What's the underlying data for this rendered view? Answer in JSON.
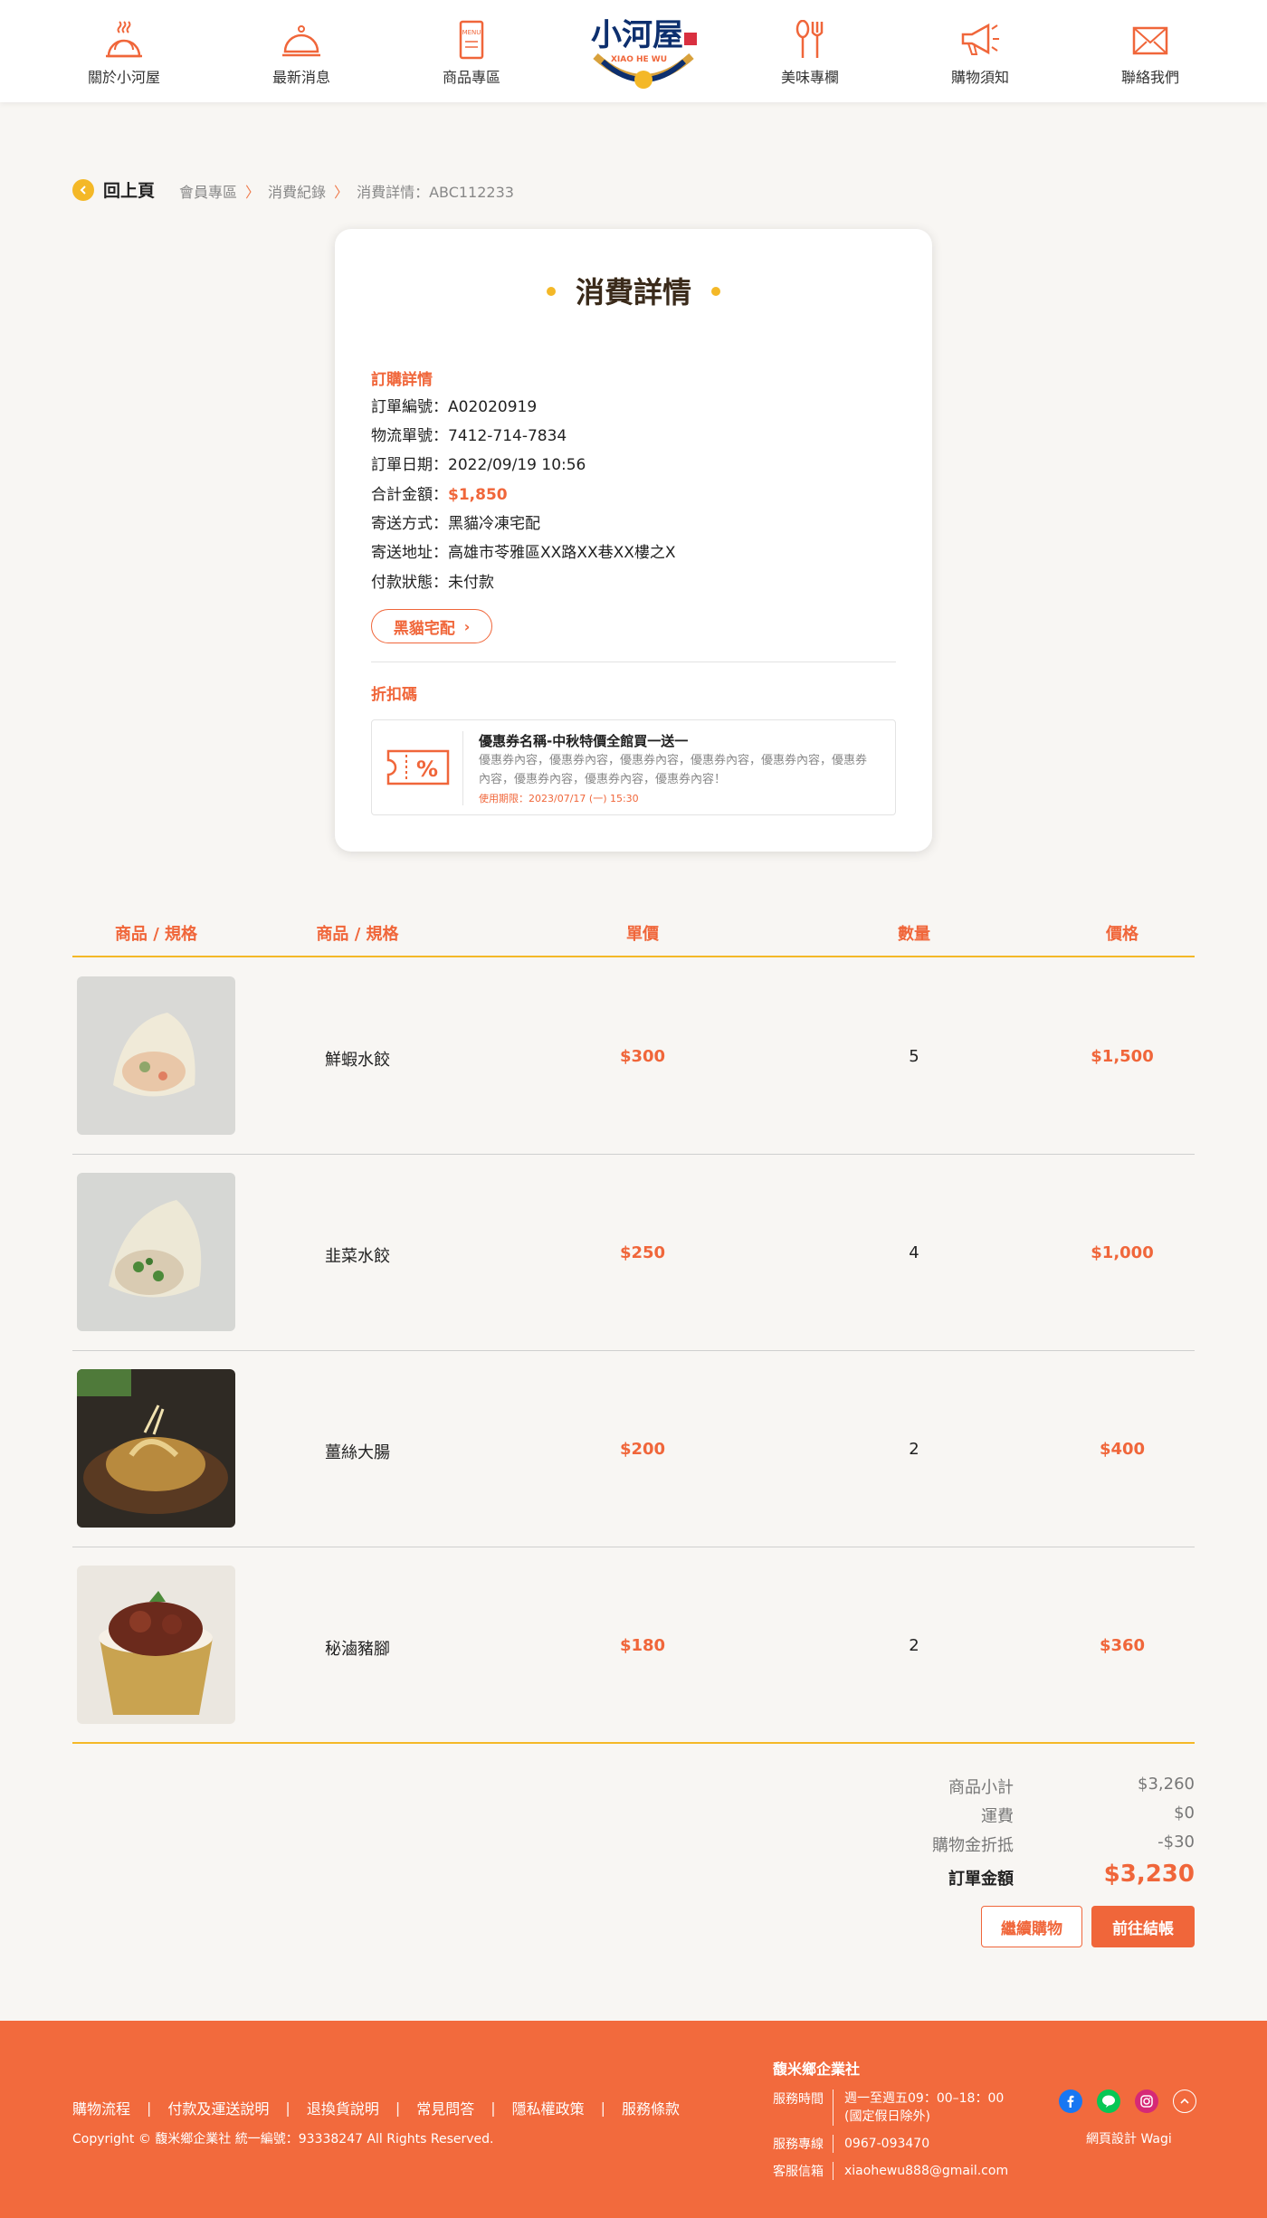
{
  "brand": {
    "logo_name": "小河屋",
    "logo_sub": "XIAO HE WU"
  },
  "nav": [
    {
      "label": "關於小河屋",
      "icon": "food-cover-icon"
    },
    {
      "label": "最新消息",
      "icon": "cloche-icon"
    },
    {
      "label": "商品專區",
      "icon": "menu-book-icon"
    },
    {
      "label": "美味專欄",
      "icon": "spoon-fork-icon"
    },
    {
      "label": "購物須知",
      "icon": "megaphone-icon"
    },
    {
      "label": "聯絡我們",
      "icon": "envelope-icon"
    }
  ],
  "back_label": "回上頁",
  "breadcrumb": [
    "會員專區",
    "消費紀錄",
    "消費詳情：ABC112233"
  ],
  "card": {
    "title": "消費詳情",
    "order_section": "訂購詳情",
    "rows": [
      {
        "k": "訂單編號：",
        "v": "A02020919"
      },
      {
        "k": "物流單號：",
        "v": "7412-714-7834"
      },
      {
        "k": "訂單日期：",
        "v": "2022/09/19 10:56"
      },
      {
        "k": "合計金額：",
        "v": "$1,850"
      },
      {
        "k": "寄送方式：",
        "v": "黑貓冷凍宅配"
      },
      {
        "k": "寄送地址：",
        "v": "高雄市苓雅區XX路XX巷XX樓之X"
      },
      {
        "k": "付款狀態：",
        "v": "未付款"
      }
    ],
    "tracking_button": "黑貓宅配",
    "discount_section": "折扣碼",
    "coupon": {
      "name": "優惠券名稱-中秋特價全館買一送一",
      "desc": "優惠券內容，優惠券內容，優惠券內容，優惠券內容，優惠券內容，優惠券內容，優惠券內容，優惠券內容，優惠券內容！",
      "expiry": "使用期限：2023/07/17 (一) 15:30"
    }
  },
  "table": {
    "headers": [
      "商品 / 規格",
      "商品 / 規格",
      "單價",
      "數量",
      "價格"
    ],
    "rows": [
      {
        "name": "鮮蝦水餃",
        "unit": "$300",
        "qty": "5",
        "price": "$1,500"
      },
      {
        "name": "韭菜水餃",
        "unit": "$250",
        "qty": "4",
        "price": "$1,000"
      },
      {
        "name": "薑絲大腸",
        "unit": "$200",
        "qty": "2",
        "price": "$400"
      },
      {
        "name": "秘滷豬腳",
        "unit": "$180",
        "qty": "2",
        "price": "$360"
      }
    ]
  },
  "summary": [
    {
      "k": "商品小計",
      "v": "$3,260"
    },
    {
      "k": "運費",
      "v": "$0"
    },
    {
      "k": "購物金折抵",
      "v": "-$30"
    },
    {
      "k": "訂單金額",
      "v": "$3,230"
    }
  ],
  "buttons": {
    "continue": "繼續購物",
    "checkout": "前往結帳"
  },
  "footer": {
    "links": [
      "購物流程",
      "付款及運送說明",
      "退換貨說明",
      "常見問答",
      "隱私權政策",
      "服務條款"
    ],
    "copyright": "Copyright © 馥米鄉企業社 統一編號：93338247 All Rights Reserved.",
    "company": "馥米鄉企業社",
    "info": [
      {
        "k": "服務時間",
        "v": "週一至週五09：00–18：00",
        "v2": "(國定假日除外)"
      },
      {
        "k": "服務專線",
        "v": "0967-093470"
      },
      {
        "k": "客服信箱",
        "v": "xiaohewu888@gmail.com"
      }
    ],
    "credit": "網頁設計 Wagi"
  },
  "colors": {
    "accent": "#f0663a",
    "yellow": "#f4b827",
    "footer": "#f26a3d"
  }
}
